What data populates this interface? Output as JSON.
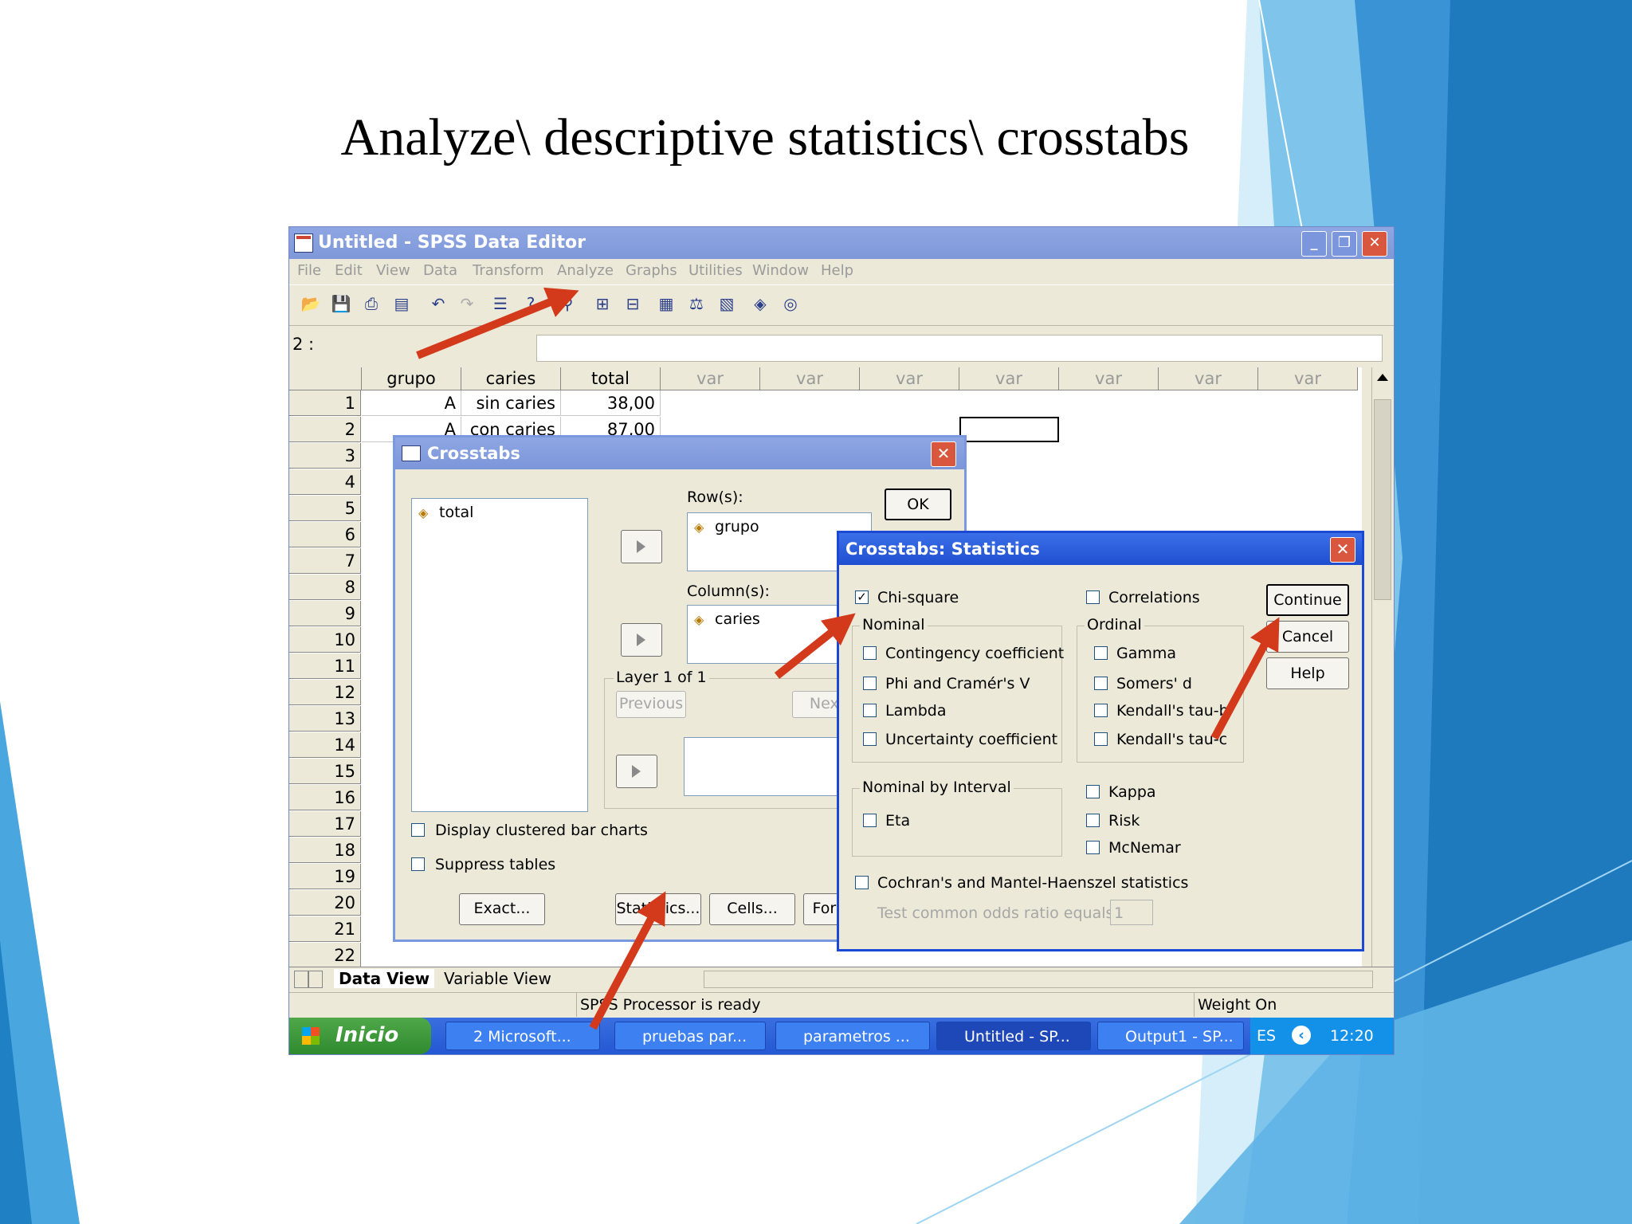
{
  "slide": {
    "title": "Analyze\\ descriptive statistics\\ crosstabs"
  },
  "window": {
    "title": "Untitled - SPSS Data Editor",
    "menu": [
      "File",
      "Edit",
      "View",
      "Data",
      "Transform",
      "Analyze",
      "Graphs",
      "Utilities",
      "Window",
      "Help"
    ],
    "cell_ref": "2 :",
    "columns": [
      "grupo",
      "caries",
      "total",
      "var",
      "var",
      "var",
      "var",
      "var",
      "var",
      "var"
    ],
    "rows": [
      {
        "n": "1",
        "grupo": "A",
        "caries": "sin caries",
        "total": "38,00"
      },
      {
        "n": "2",
        "grupo": "A",
        "caries": "con caries",
        "total": "87,00"
      }
    ],
    "row_numbers": [
      "3",
      "4",
      "5",
      "6",
      "7",
      "8",
      "9",
      "10",
      "11",
      "12",
      "13",
      "14",
      "15",
      "16",
      "17",
      "18",
      "19",
      "20",
      "21",
      "22"
    ],
    "tabs": {
      "data_view": "Data View",
      "variable_view": "Variable View"
    },
    "status": {
      "processor": "SPSS Processor  is ready",
      "weight": "Weight On"
    }
  },
  "taskbar": {
    "start": "Inicio",
    "items": [
      "2 Microsoft...",
      "pruebas par...",
      "parametros ...",
      "Untitled - SP...",
      "Output1 - SP..."
    ],
    "lang": "ES",
    "clock": "12:20"
  },
  "crosstabs": {
    "title": "Crosstabs",
    "source_vars": [
      "total"
    ],
    "rows_label": "Row(s):",
    "rows_vars": [
      "grupo"
    ],
    "columns_label": "Column(s):",
    "columns_vars": [
      "caries"
    ],
    "layer_label": "Layer 1 of 1",
    "previous": "Previous",
    "next": "Next",
    "ok": "OK",
    "display_clustered": "Display clustered bar charts",
    "suppress_tables": "Suppress tables",
    "exact": "Exact...",
    "statistics": "Statistics...",
    "cells": "Cells...",
    "format": "Format..."
  },
  "stats": {
    "title": "Crosstabs: Statistics",
    "chi_square": "Chi-square",
    "chi_square_checked": true,
    "correlations": "Correlations",
    "nominal": "Nominal",
    "nominal_items": [
      "Contingency coefficient",
      "Phi and Cramér's V",
      "Lambda",
      "Uncertainty coefficient"
    ],
    "ordinal": "Ordinal",
    "ordinal_items": [
      "Gamma",
      "Somers' d",
      "Kendall's tau-b",
      "Kendall's tau-c"
    ],
    "nominal_by_interval": "Nominal by Interval",
    "eta": "Eta",
    "other_items": [
      "Kappa",
      "Risk",
      "McNemar"
    ],
    "cochran": "Cochran's and Mantel-Haenszel statistics",
    "odds_label": "Test common odds ratio equals:",
    "odds_value": "1",
    "continue": "Continue",
    "cancel": "Cancel",
    "help": "Help"
  },
  "colors": {
    "annotation_arrow": "#d23a1b",
    "deco_blue": "#2a8fd0",
    "deco_light": "#7cc6ee"
  }
}
